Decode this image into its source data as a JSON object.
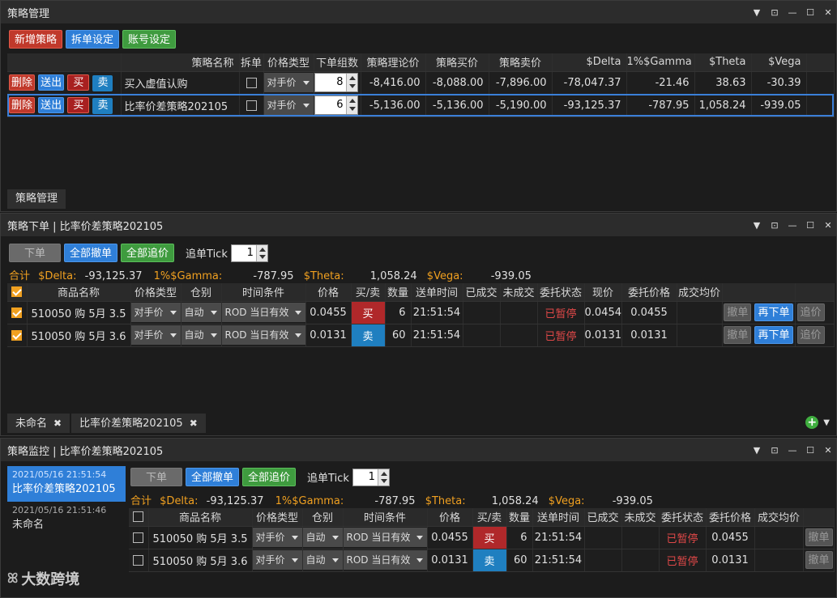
{
  "p1": {
    "title": "策略管理",
    "buttons": {
      "add": "新增策略",
      "split": "拆单设定",
      "account": "账号设定"
    },
    "headers": [
      "策略名称",
      "拆单",
      "价格类型",
      "下单组数",
      "策略理论价",
      "策略买价",
      "策略卖价",
      "$Delta",
      "1%$Gamma",
      "$Theta",
      "$Vega"
    ],
    "row_btns": {
      "del": "删除",
      "send": "送出",
      "buy": "买",
      "sell": "卖"
    },
    "rows": [
      {
        "name": "买入虚值认购",
        "pt": "对手价",
        "qty": "8",
        "theo": "-8,416.00",
        "bid": "-8,088.00",
        "ask": "-7,896.00",
        "delta": "-78,047.37",
        "gamma": "-21.46",
        "theta": "38.63",
        "vega": "-30.39"
      },
      {
        "name": "比率价差策略202105",
        "pt": "对手价",
        "qty": "6",
        "theo": "-5,136.00",
        "bid": "-5,136.00",
        "ask": "-5,190.00",
        "delta": "-93,125.37",
        "gamma": "-787.95",
        "theta": "1,058.24",
        "vega": "-939.05"
      }
    ],
    "tab": "策略管理"
  },
  "p2": {
    "title": "策略下单 | 比率价差策略202105",
    "buttons": {
      "order": "下单",
      "cancel_all": "全部撤单",
      "chase_all": "全部追价"
    },
    "tick_label": "追单Tick",
    "tick": "1",
    "sum": {
      "total": "合计",
      "delta_l": "$Delta:",
      "delta": "-93,125.37",
      "gamma_l": "1%$Gamma:",
      "gamma": "-787.95",
      "theta_l": "$Theta:",
      "theta": "1,058.24",
      "vega_l": "$Vega:",
      "vega": "-939.05"
    },
    "headers": [
      "商品名称",
      "价格类型",
      "仓别",
      "时间条件",
      "价格",
      "买/卖",
      "数量",
      "送单时间",
      "已成交",
      "未成交",
      "委托状态",
      "现价",
      "委托价格",
      "成交均价"
    ],
    "row_btns": {
      "cancel": "撤单",
      "reorder": "再下单",
      "chase": "追价"
    },
    "rows": [
      {
        "name": "510050 购 5月 3.5",
        "pt": "对手价",
        "pos": "自动",
        "tc": "ROD 当日有效",
        "price": "0.0455",
        "side": "买",
        "qty": "6",
        "time": "21:51:54",
        "status": "已暂停",
        "last": "0.0454",
        "oprice": "0.0455"
      },
      {
        "name": "510050 购 5月 3.6",
        "pt": "对手价",
        "pos": "自动",
        "tc": "ROD 当日有效",
        "price": "0.0131",
        "side": "卖",
        "qty": "60",
        "time": "21:51:54",
        "status": "已暂停",
        "last": "0.0131",
        "oprice": "0.0131"
      }
    ],
    "tabs": [
      "未命名",
      "比率价差策略202105"
    ]
  },
  "p3": {
    "title": "策略监控 | 比率价差策略202105",
    "list": [
      {
        "time": "2021/05/16 21:51:54",
        "name": "比率价差策略202105"
      },
      {
        "time": "2021/05/16 21:51:46",
        "name": "未命名"
      }
    ],
    "buttons": {
      "order": "下单",
      "cancel_all": "全部撤单",
      "chase_all": "全部追价"
    },
    "tick_label": "追单Tick",
    "tick": "1",
    "sum": {
      "total": "合计",
      "delta_l": "$Delta:",
      "delta": "-93,125.37",
      "gamma_l": "1%$Gamma:",
      "gamma": "-787.95",
      "theta_l": "$Theta:",
      "theta": "1,058.24",
      "vega_l": "$Vega:",
      "vega": "-939.05"
    },
    "headers": [
      "商品名称",
      "价格类型",
      "仓别",
      "时间条件",
      "价格",
      "买/卖",
      "数量",
      "送单时间",
      "已成交",
      "未成交",
      "委托状态",
      "委托价格",
      "成交均价"
    ],
    "row_btn": "撤单",
    "rows": [
      {
        "name": "510050 购 5月 3.5",
        "pt": "对手价",
        "pos": "自动",
        "tc": "ROD 当日有效",
        "price": "0.0455",
        "side": "买",
        "qty": "6",
        "time": "21:51:54",
        "status": "已暂停",
        "oprice": "0.0455"
      },
      {
        "name": "510050 购 5月 3.6",
        "pt": "对手价",
        "pos": "自动",
        "tc": "ROD 当日有效",
        "price": "0.0131",
        "side": "卖",
        "qty": "60",
        "time": "21:51:54",
        "status": "已暂停",
        "oprice": "0.0131"
      }
    ],
    "logo": "大数跨境"
  }
}
